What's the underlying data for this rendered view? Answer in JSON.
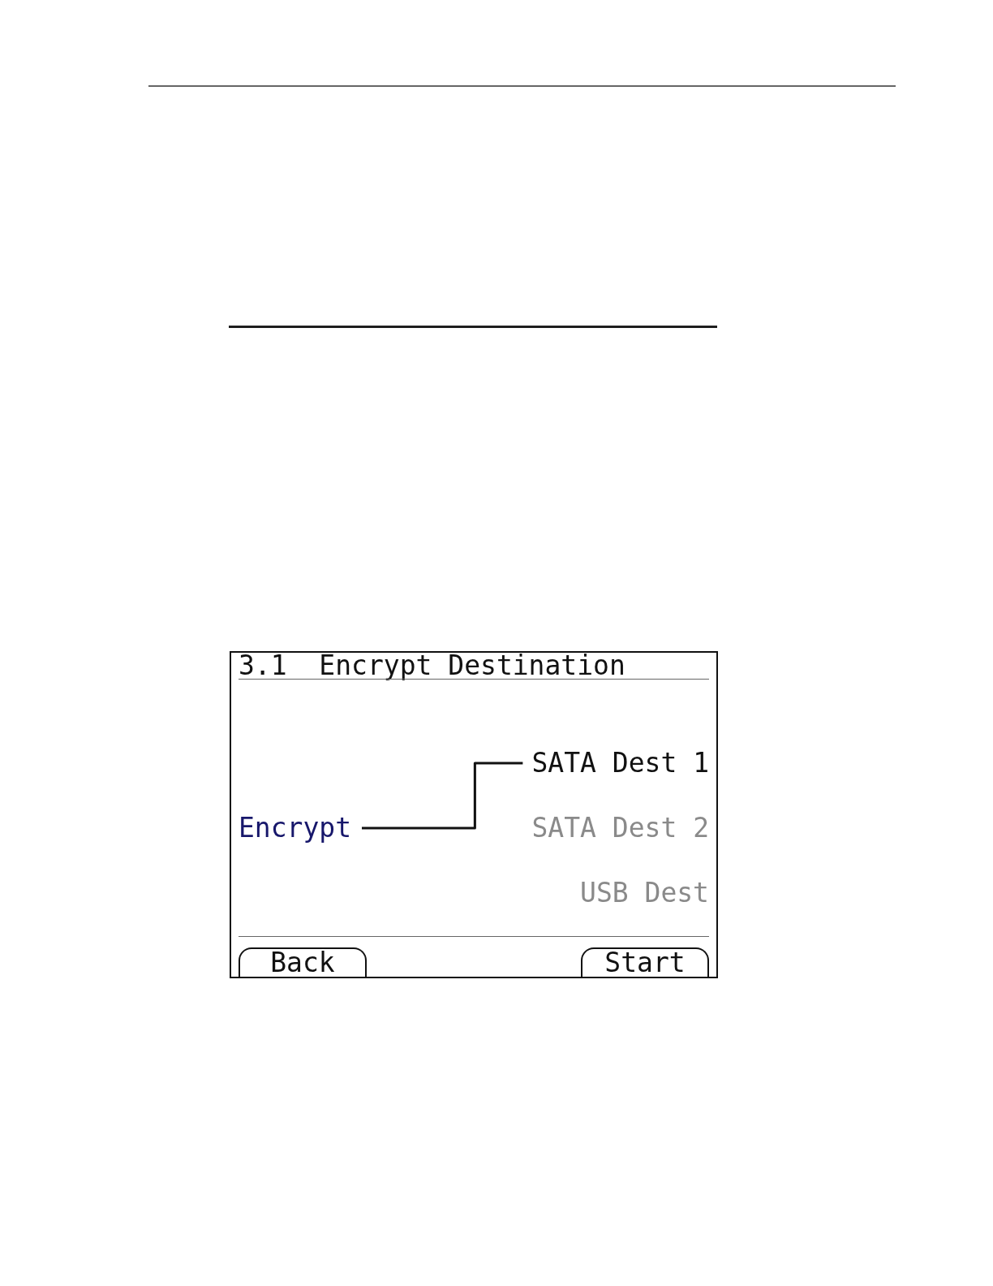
{
  "screen": {
    "title": "3.1  Encrypt Destination",
    "source": "Encrypt",
    "destinations": [
      {
        "label": "SATA Dest 1",
        "selected": true
      },
      {
        "label": "SATA Dest 2",
        "selected": false
      },
      {
        "label": "USB Dest",
        "selected": false
      }
    ],
    "softkeys": [
      {
        "label": "Back"
      },
      {
        "label": "Start"
      }
    ]
  }
}
